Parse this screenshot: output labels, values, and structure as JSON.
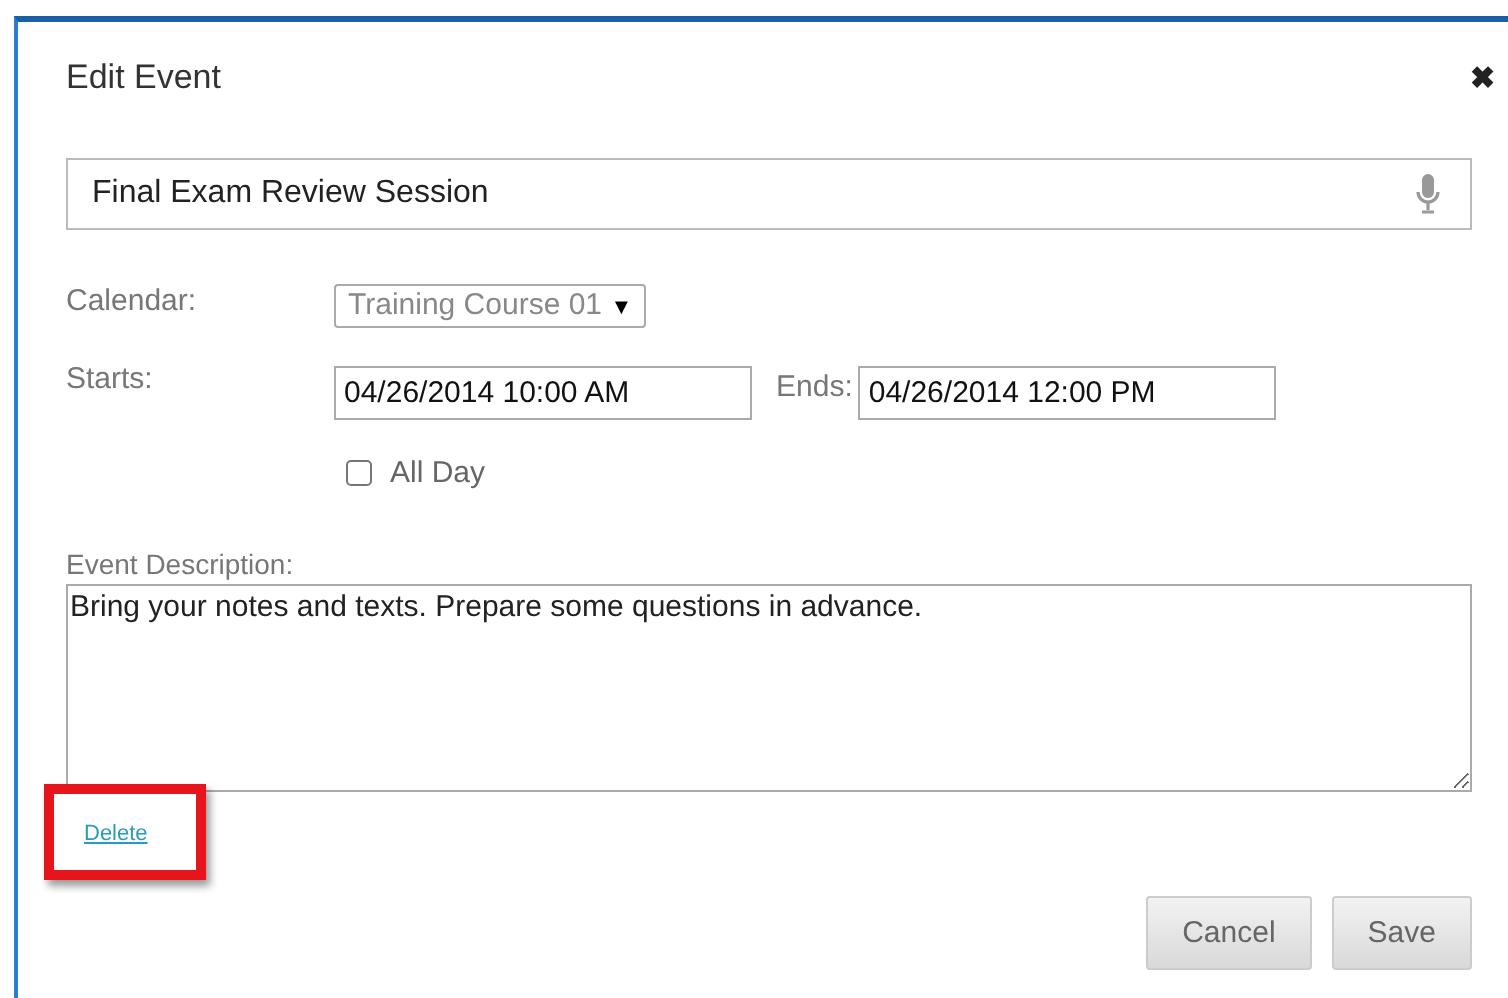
{
  "dialog": {
    "title": "Edit Event",
    "close": "✖"
  },
  "event_title": {
    "value": "Final Exam Review Session"
  },
  "calendar": {
    "label": "Calendar:",
    "value": "Training Course 01",
    "caret": "▼"
  },
  "starts": {
    "label": "Starts:",
    "value": "04/26/2014 10:00 AM"
  },
  "ends": {
    "label": "Ends:",
    "value": "04/26/2014 12:00 PM"
  },
  "all_day": {
    "label": "All Day",
    "checked": false
  },
  "description": {
    "label": "Event Description:",
    "value": "Bring your notes and texts. Prepare some questions in advance."
  },
  "delete_link": {
    "label": "Delete",
    "highlighted": true
  },
  "buttons": [
    {
      "label": "Cancel"
    },
    {
      "label": "Save"
    }
  ]
}
